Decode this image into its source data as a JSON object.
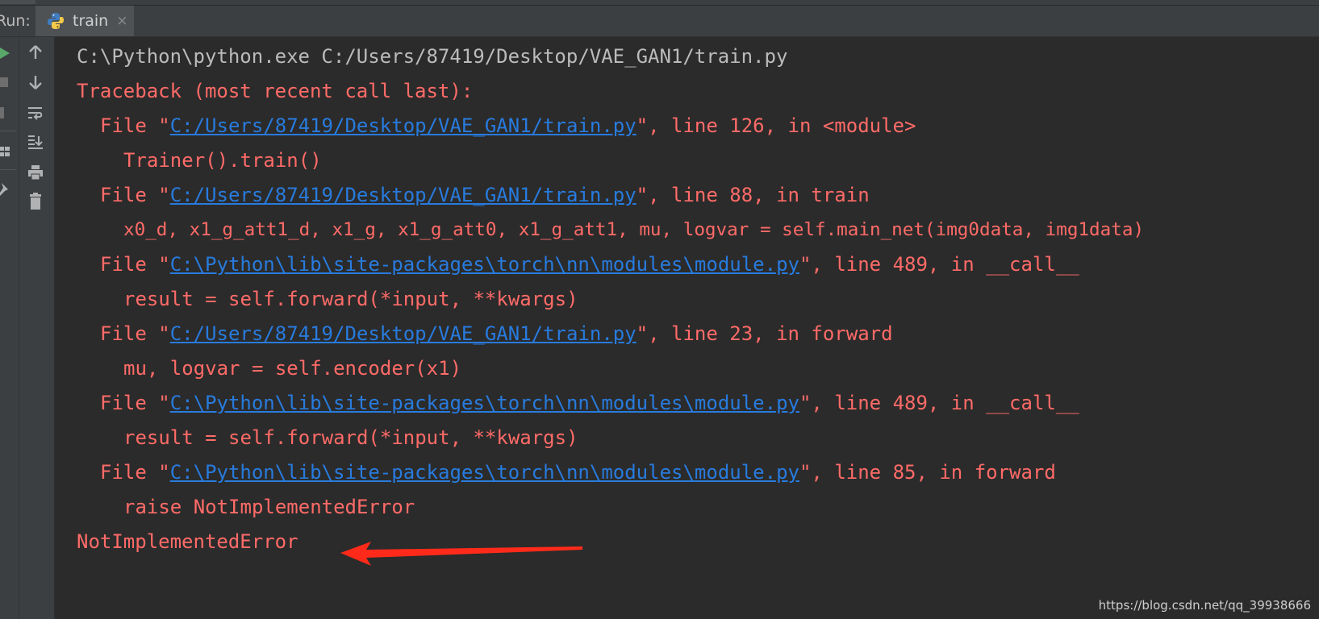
{
  "header": {
    "run_label": "Run:",
    "tab_title": "train",
    "tab_close": "×"
  },
  "toolbar": {
    "icons": [
      "arrow-up-icon",
      "arrow-down-icon",
      "soft-wrap-icon",
      "scroll-to-end-icon",
      "print-icon",
      "trash-icon"
    ]
  },
  "colors": {
    "stderr": "#ff6b68",
    "stdout": "#bbbbbb",
    "link": "#287bde",
    "background": "#2b2b2b",
    "arrow": "#ff2a1a"
  },
  "console": {
    "command": "C:\\Python\\python.exe C:/Users/87419/Desktop/VAE_GAN1/train.py",
    "traceback_header": "Traceback (most recent call last):",
    "frames": [
      {
        "file_prefix": "File \"",
        "path": "C:/Users/87419/Desktop/VAE_GAN1/train.py",
        "suffix": "\", line 126, in <module>",
        "code": "Trainer().train()"
      },
      {
        "file_prefix": "File \"",
        "path": "C:/Users/87419/Desktop/VAE_GAN1/train.py",
        "suffix": "\", line 88, in train",
        "code": "x0_d, x1_g_att1_d, x1_g, x1_g_att0, x1_g_att1, mu, logvar = self.main_net(img0data, img1data)"
      },
      {
        "file_prefix": "File \"",
        "path": "C:\\Python\\lib\\site-packages\\torch\\nn\\modules\\module.py",
        "suffix": "\", line 489, in __call__",
        "code": "result = self.forward(*input, **kwargs)"
      },
      {
        "file_prefix": "File \"",
        "path": "C:/Users/87419/Desktop/VAE_GAN1/train.py",
        "suffix": "\", line 23, in forward",
        "code": "mu, logvar = self.encoder(x1)"
      },
      {
        "file_prefix": "File \"",
        "path": "C:\\Python\\lib\\site-packages\\torch\\nn\\modules\\module.py",
        "suffix": "\", line 489, in __call__",
        "code": "result = self.forward(*input, **kwargs)"
      },
      {
        "file_prefix": "File \"",
        "path": "C:\\Python\\lib\\site-packages\\torch\\nn\\modules\\module.py",
        "suffix": "\", line 85, in forward",
        "code": "raise NotImplementedError"
      }
    ],
    "error": "NotImplementedError"
  },
  "watermark": "https://blog.csdn.net/qq_39938666"
}
